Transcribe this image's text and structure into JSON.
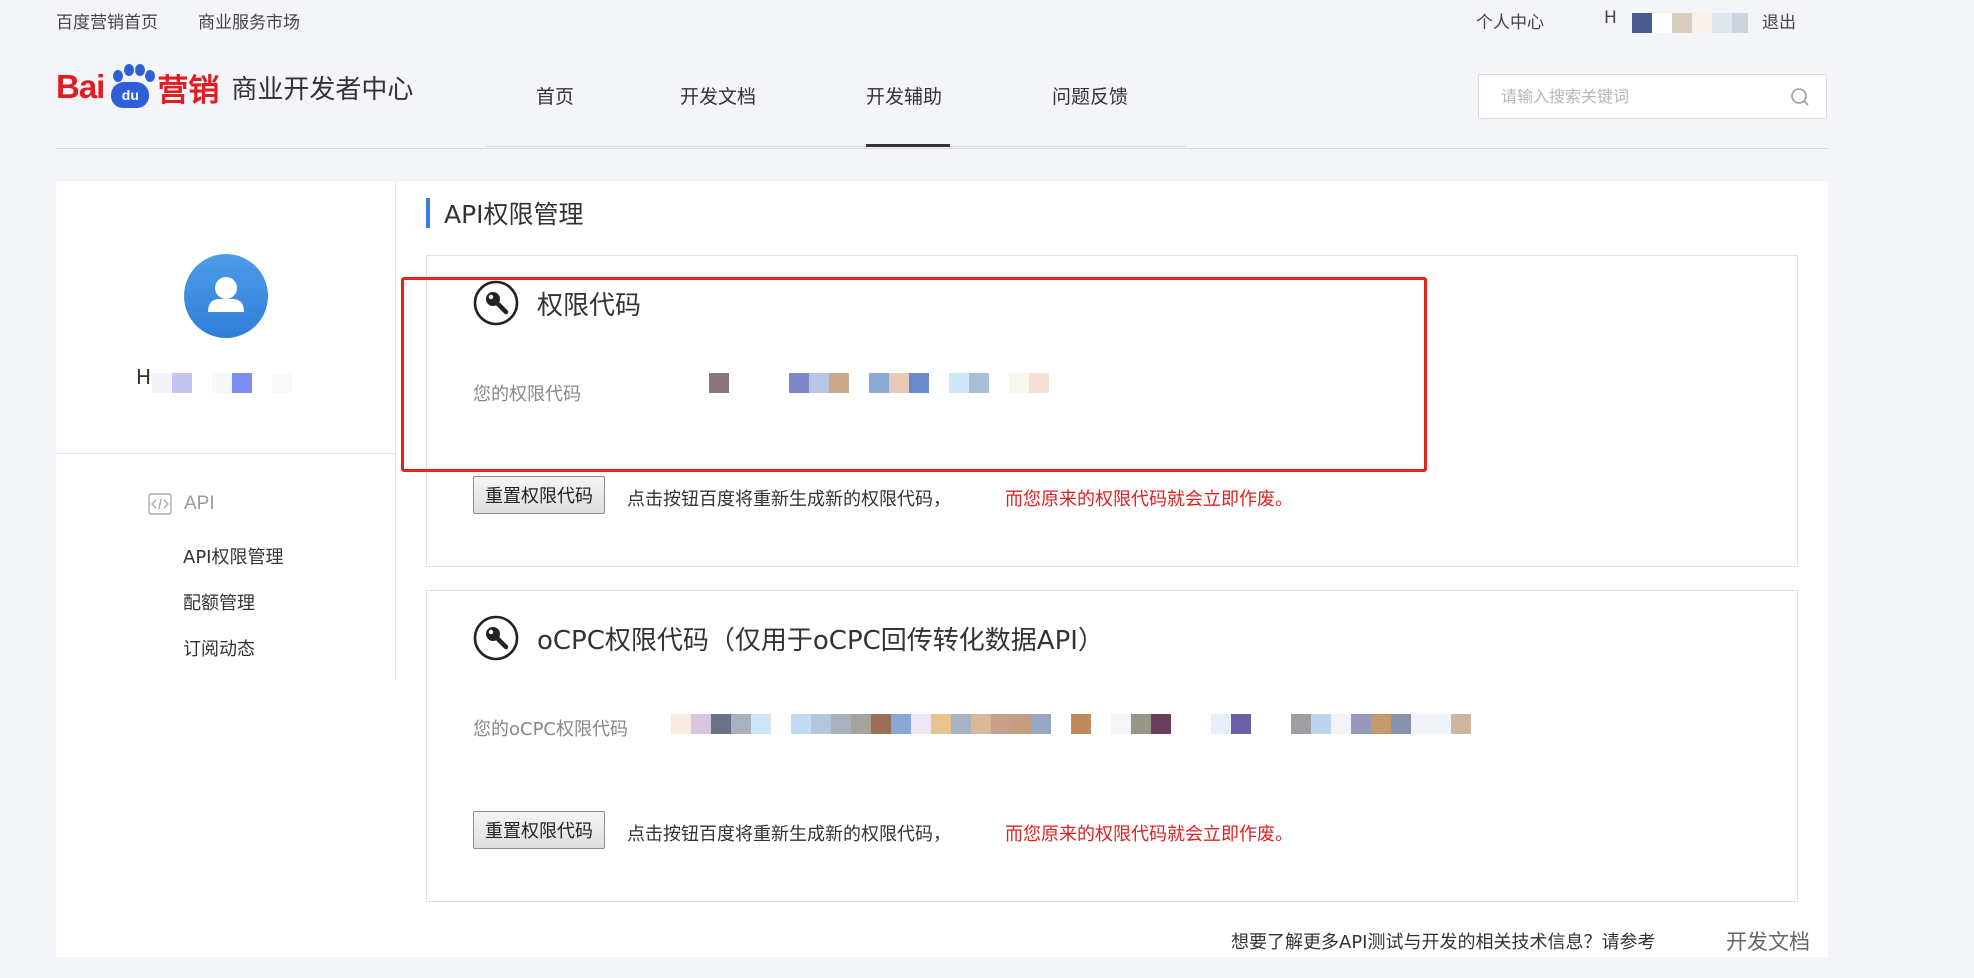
{
  "topbar": {
    "home_link": "百度营销首页",
    "market_link": "商业服务市场",
    "personal_center": "个人中心",
    "user_initial": "H",
    "logout": "退出"
  },
  "header": {
    "logo_bai": "Bai",
    "logo_du": "du",
    "logo_ying": "营销",
    "logo_title": "商业开发者中心",
    "nav": [
      "首页",
      "开发文档",
      "开发辅助",
      "问题反馈"
    ],
    "active_nav": "开发辅助",
    "search_placeholder": "请输入搜索关键词"
  },
  "sidebar": {
    "user_initial": "H",
    "group_label": "API",
    "items": [
      "API权限管理",
      "配额管理",
      "订阅动态"
    ]
  },
  "content": {
    "page_title": "API权限管理",
    "card1": {
      "title": "权限代码",
      "code_label": "您的权限代码",
      "reset_button": "重置权限代码",
      "hint": "点击按钮百度将重新生成新的权限代码，",
      "warning": "而您原来的权限代码就会立即作废。"
    },
    "card2": {
      "title": "oCPC权限代码（仅用于oCPC回传转化数据API）",
      "code_label": "您的oCPC权限代码",
      "reset_button": "重置权限代码",
      "hint": "点击按钮百度将重新生成新的权限代码，",
      "warning": "而您原来的权限代码就会立即作废。"
    },
    "footer_note": "想要了解更多API测试与开发的相关技术信息？请参考",
    "footer_link": "开发文档"
  },
  "colors": {
    "brand_red": "#e11d24",
    "brand_blue": "#2f5fd8",
    "accent_blue": "#3a7ee8",
    "warning_red": "#e02020",
    "highlight_box": "#e1251b"
  }
}
